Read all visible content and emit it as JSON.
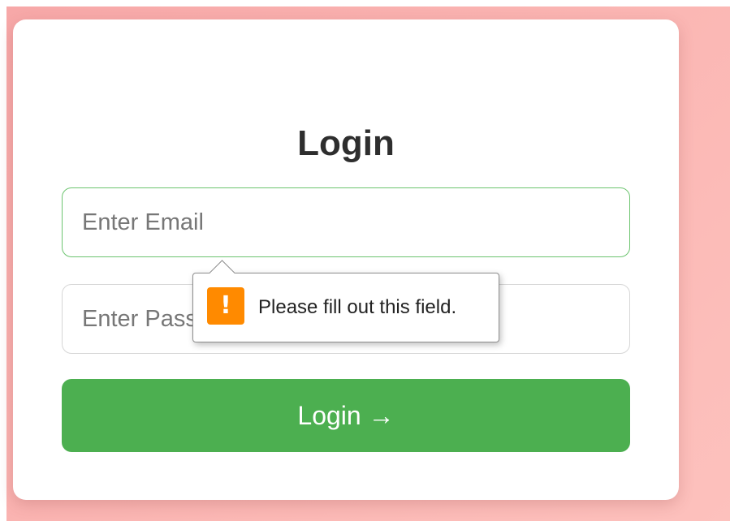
{
  "form": {
    "title": "Login",
    "email": {
      "value": "",
      "placeholder": "Enter Email"
    },
    "password": {
      "value": "",
      "placeholder": "Enter Password"
    },
    "submit_label": "Login →"
  },
  "validation": {
    "message": "Please fill out this field.",
    "icon": "warning-icon"
  },
  "colors": {
    "background": "#f7a8a8",
    "accent": "#4caf50",
    "warning": "#ff8a00",
    "focus_border": "#6cc46f"
  }
}
